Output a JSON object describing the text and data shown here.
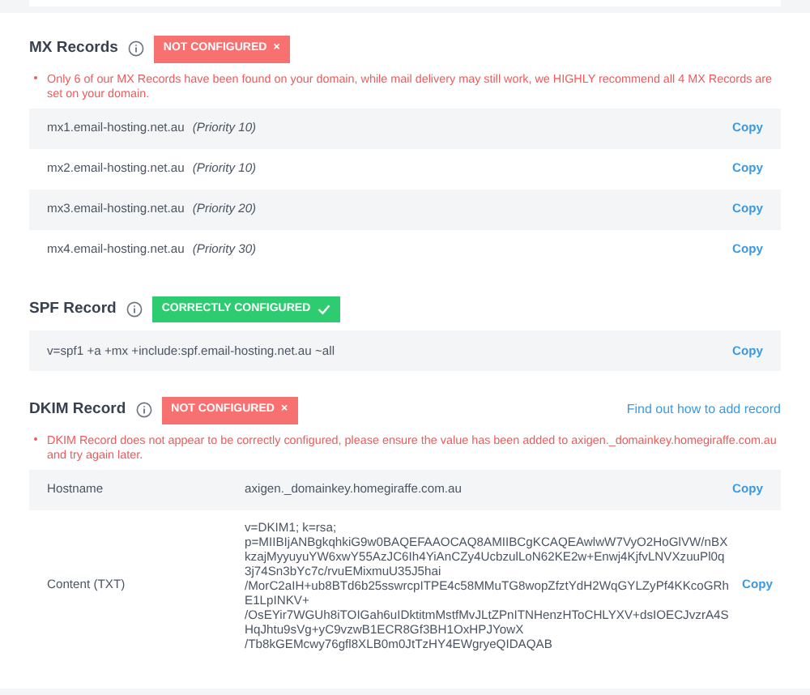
{
  "sections": [
    {
      "title": "MX Records",
      "status": {
        "kind": "error",
        "label": "NOT CONFIGURED",
        "symbol": "×"
      },
      "warning": "Only 6 of our MX Records have been found on your domain, while mail delivery may still work, we HIGHLY recommend all 4 MX Records are set on your domain.",
      "rows": [
        {
          "value": "mx1.email-hosting.net.au",
          "note": "(Priority 10)",
          "action": "Copy"
        },
        {
          "value": "mx2.email-hosting.net.au",
          "note": "(Priority 10)",
          "action": "Copy"
        },
        {
          "value": "mx3.email-hosting.net.au",
          "note": "(Priority 20)",
          "action": "Copy"
        },
        {
          "value": "mx4.email-hosting.net.au",
          "note": "(Priority 30)",
          "action": "Copy"
        }
      ]
    },
    {
      "title": "SPF Record",
      "status": {
        "kind": "success",
        "label": "CORRECTLY CONFIGURED"
      },
      "rows": [
        {
          "value": "v=spf1 +a +mx +include:spf.email-hosting.net.au ~all",
          "action": "Copy"
        }
      ]
    },
    {
      "title": "DKIM Record",
      "status": {
        "kind": "error",
        "label": "NOT CONFIGURED",
        "symbol": "×"
      },
      "link": "Find out how to add record",
      "warning": "DKIM Record does not appear to be correctly configured, please ensure the value has been added to axigen._domainkey.homegiraffe.com.au and try again later.",
      "rows": [
        {
          "label": "Hostname",
          "value": "axigen._domainkey.homegiraffe.com.au",
          "action": "Copy"
        },
        {
          "label": "Content (TXT)",
          "lines": [
            "v=DKIM1; k=rsa;",
            "p=MIIBIjANBgkqhkiG9w0BAQEFAAOCAQ8AMIIBCgKCAQEAwlwW7VyO2HoGlVW/nBX",
            "kzajMyyuyuYW6xwY55AzJC6Ih4YiAnCZy4UcbzulLoN62KE2w+Enwj4KjfvLNVXzuuPl0q",
            "3j74Sn3bYc7c/rvuEMixmuU35J5hai",
            "/MorC2aIH+ub8BTd6b25sswrcpITPE4c58MMuTG8wopZfztYdH2WqGYLZyPf4KKcoGRh",
            "E1LpINKV+",
            "/OsEYir7WGUh8iTOIGah6uIDktitmMstfMvJLtZPnITNHenzHToCHLYXV+dsIOECJvzrA4S",
            "HqJhtu9sVg+yC9vzwB1ECR8Gf3BH1OxHPJYowX",
            "/Tb8kGEMcwy76gfl8XLB0m0JtTzHY4EWgryeQIDAQAB"
          ],
          "action": "Copy"
        }
      ]
    }
  ]
}
